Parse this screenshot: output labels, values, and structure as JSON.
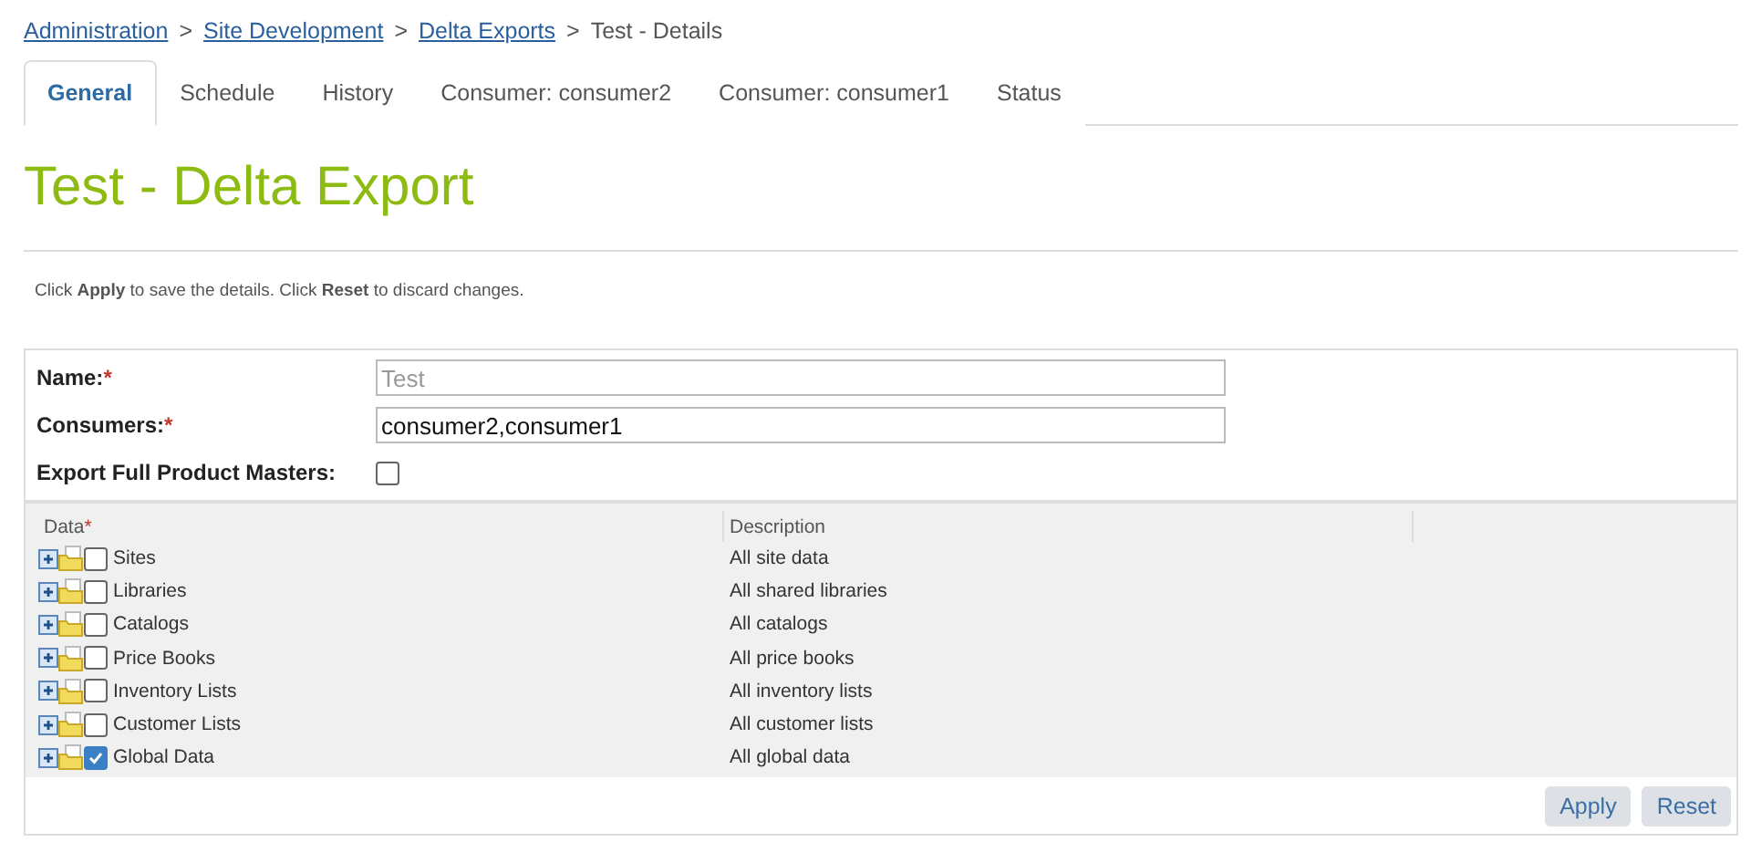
{
  "breadcrumb": {
    "links": [
      "Administration",
      "Site Development",
      "Delta Exports"
    ],
    "separator": ">",
    "current": "Test - Details"
  },
  "tabs": [
    {
      "label": "General",
      "selected": true
    },
    {
      "label": "Schedule",
      "selected": false
    },
    {
      "label": "History",
      "selected": false
    },
    {
      "label": "Consumer: consumer2",
      "selected": false
    },
    {
      "label": "Consumer: consumer1",
      "selected": false
    },
    {
      "label": "Status",
      "selected": false
    }
  ],
  "title": "Test - Delta Export",
  "info": "Click **Apply** to save the details. Click **Reset** to discard changes.",
  "form": {
    "fields": [
      {
        "kind": "text",
        "label": "Name:",
        "required_mark": "*",
        "value": "Test",
        "disabled": true
      },
      {
        "kind": "text",
        "label": "Consumers:",
        "required_mark": "*",
        "value": "consumer2,consumer1",
        "disabled": false
      },
      {
        "kind": "checkbox",
        "label": "Export Full Product Masters:",
        "checked": false
      }
    ]
  },
  "tree": {
    "columns": [
      {
        "label": "Data",
        "required_mark": "*"
      },
      {
        "label": "Description"
      }
    ],
    "rows": [
      {
        "label": "Sites",
        "description": "All site data",
        "checked": false,
        "expanded": false
      },
      {
        "label": "Libraries",
        "description": "All shared libraries",
        "checked": false,
        "expanded": false
      },
      {
        "label": "Catalogs",
        "description": "All catalogs",
        "checked": false,
        "expanded": false
      },
      {
        "label": "Price Books",
        "description": "All price books",
        "checked": false,
        "expanded": false
      },
      {
        "label": "Inventory Lists",
        "description": "All inventory lists",
        "checked": false,
        "expanded": false
      },
      {
        "label": "Customer Lists",
        "description": "All customer lists",
        "checked": false,
        "expanded": false
      },
      {
        "label": "Global Data",
        "description": "All global data",
        "checked": true,
        "expanded": false
      }
    ]
  },
  "buttons": [
    "Apply",
    "Reset"
  ]
}
